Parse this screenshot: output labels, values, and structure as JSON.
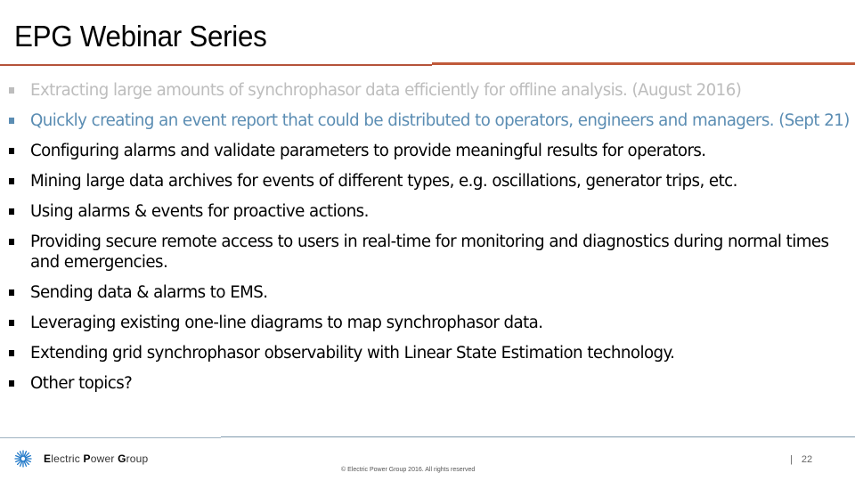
{
  "slide": {
    "title": "EPG Webinar Series",
    "bullets": [
      {
        "text": "Extracting large amounts of synchrophasor data efficiently for offline analysis. (August 2016)",
        "style": "gray"
      },
      {
        "text": "Quickly creating an event report that could be distributed to operators, engineers and managers. (Sept 21)",
        "style": "blue"
      },
      {
        "text": "Configuring alarms and validate parameters to provide meaningful results for operators.",
        "style": "black"
      },
      {
        "text": "Mining large data archives for events of different types, e.g. oscillations, generator trips, etc.",
        "style": "black"
      },
      {
        "text": "Using alarms & events for proactive actions.",
        "style": "black"
      },
      {
        "text": "Providing secure remote access to users in real-time for monitoring and diagnostics during normal times and emergencies.",
        "style": "black"
      },
      {
        "text": "Sending data & alarms to EMS.",
        "style": "black"
      },
      {
        "text": "Leveraging existing one-line diagrams to map synchrophasor data.",
        "style": "black"
      },
      {
        "text": "Extending grid synchrophasor observability with Linear State Estimation technology.",
        "style": "black"
      },
      {
        "text": "Other topics?",
        "style": "black"
      }
    ]
  },
  "footer": {
    "logo": {
      "icon": "starburst-icon",
      "word1_initial": "E",
      "word1_rest": "lectric ",
      "word2_initial": "P",
      "word2_rest": "ower ",
      "word3_initial": "G",
      "word3_rest": "roup"
    },
    "copyright": "© Electric Power Group 2016. All rights reserved",
    "page_separator": "|",
    "page_number": "22"
  },
  "colors": {
    "accent_rule": "#c05a3a",
    "completed_item": "#bdbdbd",
    "current_item": "#5b8db3",
    "logo_blue": "#1f78c8"
  }
}
